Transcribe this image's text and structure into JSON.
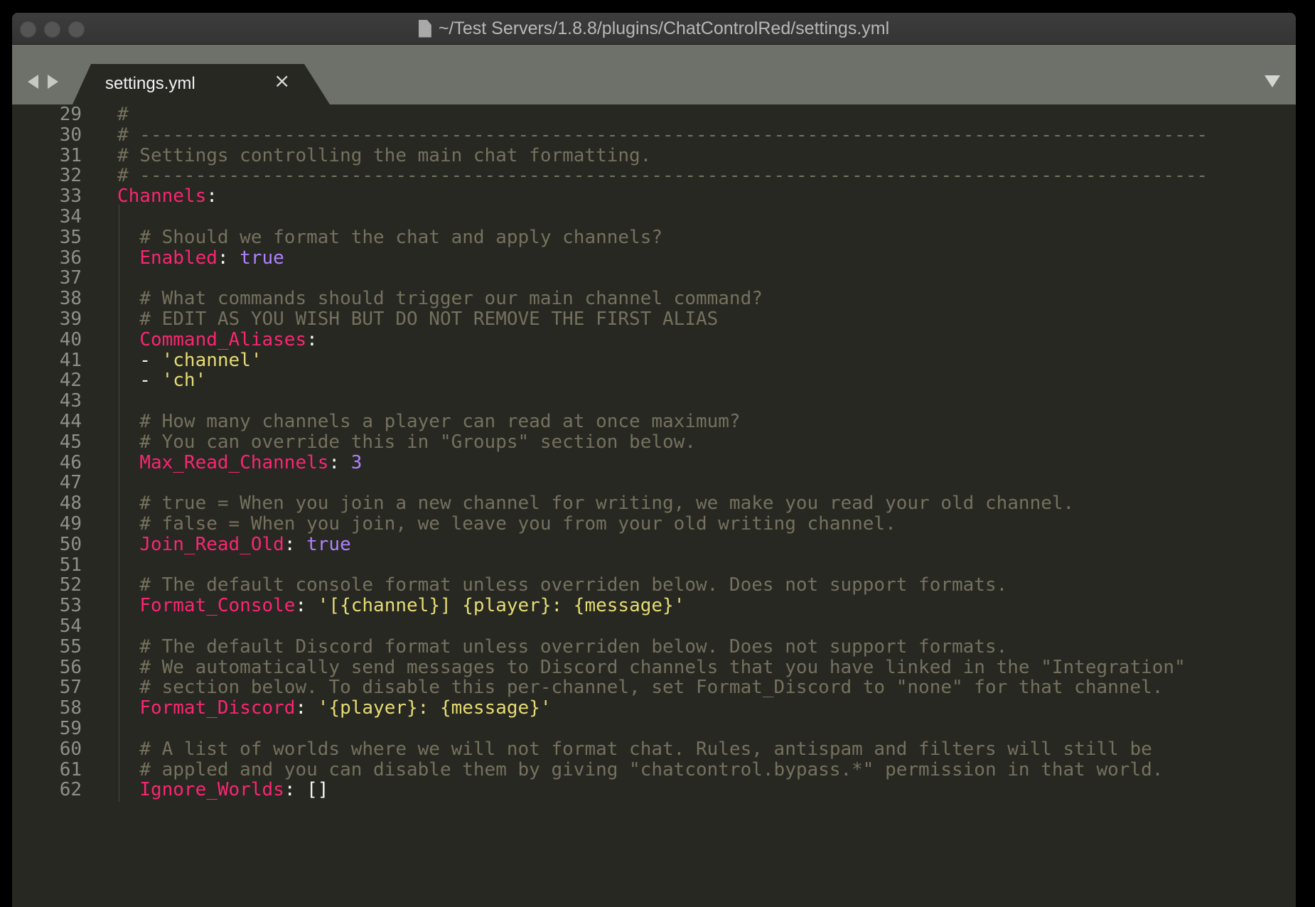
{
  "window": {
    "title": "~/Test Servers/1.8.8/plugins/ChatControlRed/settings.yml",
    "traffic_lights": [
      "close-button",
      "minimize-button",
      "zoom-button"
    ]
  },
  "tabs": [
    {
      "label": "settings.yml",
      "close_glyph": "×",
      "active": true
    }
  ],
  "editor": {
    "language": "yaml",
    "theme_colors": {
      "background": "#272822",
      "comment": "#75715e",
      "key": "#f92672",
      "string": "#e6db74",
      "constant": "#ae81ff",
      "gutter": "#8f908a"
    },
    "lines": [
      {
        "num": "29",
        "indent": false,
        "tokens": [
          {
            "t": "comment",
            "v": "#"
          }
        ]
      },
      {
        "num": "30",
        "indent": false,
        "tokens": [
          {
            "t": "comment",
            "v": "# ------------------------------------------------------------------------------------------------"
          }
        ]
      },
      {
        "num": "31",
        "indent": false,
        "tokens": [
          {
            "t": "comment",
            "v": "# Settings controlling the main chat formatting."
          }
        ]
      },
      {
        "num": "32",
        "indent": false,
        "tokens": [
          {
            "t": "comment",
            "v": "# ------------------------------------------------------------------------------------------------"
          }
        ]
      },
      {
        "num": "33",
        "indent": false,
        "tokens": [
          {
            "t": "key",
            "v": "Channels"
          },
          {
            "t": "punct",
            "v": ":"
          }
        ]
      },
      {
        "num": "34",
        "indent": true,
        "tokens": []
      },
      {
        "num": "35",
        "indent": true,
        "tokens": [
          {
            "t": "comment",
            "v": "  # Should we format the chat and apply channels?"
          }
        ]
      },
      {
        "num": "36",
        "indent": true,
        "tokens": [
          {
            "t": "punct",
            "v": "  "
          },
          {
            "t": "key",
            "v": "Enabled"
          },
          {
            "t": "punct",
            "v": ": "
          },
          {
            "t": "const",
            "v": "true"
          }
        ]
      },
      {
        "num": "37",
        "indent": true,
        "tokens": []
      },
      {
        "num": "38",
        "indent": true,
        "tokens": [
          {
            "t": "comment",
            "v": "  # What commands should trigger our main channel command?"
          }
        ]
      },
      {
        "num": "39",
        "indent": true,
        "tokens": [
          {
            "t": "comment",
            "v": "  # EDIT AS YOU WISH BUT DO NOT REMOVE THE FIRST ALIAS"
          }
        ]
      },
      {
        "num": "40",
        "indent": true,
        "tokens": [
          {
            "t": "punct",
            "v": "  "
          },
          {
            "t": "key",
            "v": "Command_Aliases"
          },
          {
            "t": "punct",
            "v": ":"
          }
        ]
      },
      {
        "num": "41",
        "indent": true,
        "tokens": [
          {
            "t": "punct",
            "v": "  - "
          },
          {
            "t": "string",
            "v": "'channel'"
          }
        ]
      },
      {
        "num": "42",
        "indent": true,
        "tokens": [
          {
            "t": "punct",
            "v": "  - "
          },
          {
            "t": "string",
            "v": "'ch'"
          }
        ]
      },
      {
        "num": "43",
        "indent": true,
        "tokens": []
      },
      {
        "num": "44",
        "indent": true,
        "tokens": [
          {
            "t": "comment",
            "v": "  # How many channels a player can read at once maximum?"
          }
        ]
      },
      {
        "num": "45",
        "indent": true,
        "tokens": [
          {
            "t": "comment",
            "v": "  # You can override this in \"Groups\" section below."
          }
        ]
      },
      {
        "num": "46",
        "indent": true,
        "tokens": [
          {
            "t": "punct",
            "v": "  "
          },
          {
            "t": "key",
            "v": "Max_Read_Channels"
          },
          {
            "t": "punct",
            "v": ": "
          },
          {
            "t": "number",
            "v": "3"
          }
        ]
      },
      {
        "num": "47",
        "indent": true,
        "tokens": []
      },
      {
        "num": "48",
        "indent": true,
        "tokens": [
          {
            "t": "comment",
            "v": "  # true = When you join a new channel for writing, we make you read your old channel."
          }
        ]
      },
      {
        "num": "49",
        "indent": true,
        "tokens": [
          {
            "t": "comment",
            "v": "  # false = When you join, we leave you from your old writing channel."
          }
        ]
      },
      {
        "num": "50",
        "indent": true,
        "tokens": [
          {
            "t": "punct",
            "v": "  "
          },
          {
            "t": "key",
            "v": "Join_Read_Old"
          },
          {
            "t": "punct",
            "v": ": "
          },
          {
            "t": "const",
            "v": "true"
          }
        ]
      },
      {
        "num": "51",
        "indent": true,
        "tokens": []
      },
      {
        "num": "52",
        "indent": true,
        "tokens": [
          {
            "t": "comment",
            "v": "  # The default console format unless overriden below. Does not support formats."
          }
        ]
      },
      {
        "num": "53",
        "indent": true,
        "tokens": [
          {
            "t": "punct",
            "v": "  "
          },
          {
            "t": "key",
            "v": "Format_Console"
          },
          {
            "t": "punct",
            "v": ": "
          },
          {
            "t": "string",
            "v": "'[{channel}] {player}: {message}'"
          }
        ]
      },
      {
        "num": "54",
        "indent": true,
        "tokens": []
      },
      {
        "num": "55",
        "indent": true,
        "tokens": [
          {
            "t": "comment",
            "v": "  # The default Discord format unless overriden below. Does not support formats."
          }
        ]
      },
      {
        "num": "56",
        "indent": true,
        "tokens": [
          {
            "t": "comment",
            "v": "  # We automatically send messages to Discord channels that you have linked in the \"Integration\""
          }
        ]
      },
      {
        "num": "57",
        "indent": true,
        "tokens": [
          {
            "t": "comment",
            "v": "  # section below. To disable this per-channel, set Format_Discord to \"none\" for that channel."
          }
        ]
      },
      {
        "num": "58",
        "indent": true,
        "tokens": [
          {
            "t": "punct",
            "v": "  "
          },
          {
            "t": "key",
            "v": "Format_Discord"
          },
          {
            "t": "punct",
            "v": ": "
          },
          {
            "t": "string",
            "v": "'{player}: {message}'"
          }
        ]
      },
      {
        "num": "59",
        "indent": true,
        "tokens": []
      },
      {
        "num": "60",
        "indent": true,
        "tokens": [
          {
            "t": "comment",
            "v": "  # A list of worlds where we will not format chat. Rules, antispam and filters will still be"
          }
        ]
      },
      {
        "num": "61",
        "indent": true,
        "tokens": [
          {
            "t": "comment",
            "v": "  # appled and you can disable them by giving \"chatcontrol.bypass.*\" permission in that world."
          }
        ]
      },
      {
        "num": "62",
        "indent": true,
        "tokens": [
          {
            "t": "punct",
            "v": "  "
          },
          {
            "t": "key",
            "v": "Ignore_Worlds"
          },
          {
            "t": "punct",
            "v": ": []"
          }
        ]
      }
    ]
  }
}
